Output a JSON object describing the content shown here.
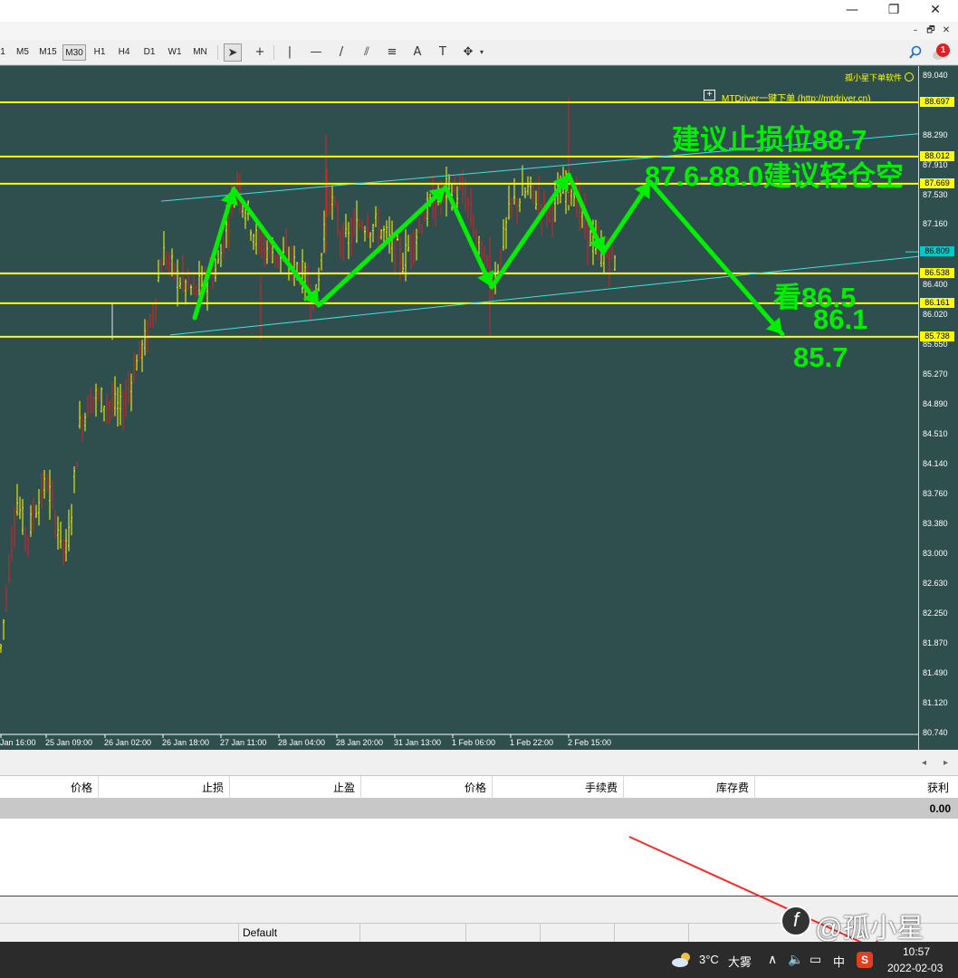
{
  "window": {
    "minimize_glyph": "—",
    "restore_glyph": "❐",
    "close_glyph": "✕"
  },
  "mdi": {
    "minimize_glyph": "–",
    "restore_glyph": "🗗",
    "close_glyph": "✕"
  },
  "toolbar": {
    "timeframes": [
      "1",
      "M5",
      "M15",
      "M30",
      "H1",
      "H4",
      "D1",
      "W1",
      "MN"
    ],
    "selected_timeframe": "M30",
    "tools": [
      "cursor-tool",
      "crosshair-tool",
      "vertical-line-tool",
      "horizontal-line-tool",
      "trendline-tool",
      "fibonacci-tool",
      "channel-tool",
      "text-tool",
      "text-label-tool",
      "arrows-tool"
    ],
    "tool_glyphs": [
      "➤",
      "+",
      "|",
      "—",
      "/",
      "⫽",
      "≡",
      "A",
      "T",
      "✥"
    ],
    "search_icon": "search-icon",
    "notification_count": "1"
  },
  "chart": {
    "background": "#2f4f4f",
    "watermark_text": "孤小星下单软件",
    "mtdriver_button": "+",
    "mtdriver_text": "MTDriver一键下单 (http://mtdriver.cn)",
    "price_ticks": [
      "89.040",
      "88.290",
      "87.910",
      "87.530",
      "87.160",
      "86.400",
      "86.020",
      "85.650",
      "85.270",
      "84.890",
      "84.510",
      "84.140",
      "83.760",
      "83.380",
      "83.000",
      "82.630",
      "82.250",
      "81.870",
      "81.490",
      "81.120",
      "80.740"
    ],
    "horizontal_lines": [
      "88.697",
      "88.012",
      "87.669",
      "86.538",
      "86.161",
      "85.738"
    ],
    "bid_price": "86.809",
    "time_ticks": [
      "Jan 16:00",
      "25 Jan 09:00",
      "26 Jan 02:00",
      "26 Jan 18:00",
      "27 Jan 11:00",
      "28 Jan 04:00",
      "28 Jan 20:00",
      "31 Jan 13:00",
      "1 Feb 06:00",
      "1 Feb 22:00",
      "2 Feb 15:00"
    ],
    "colors": {
      "hline": "#ffff00",
      "channel": "#40e0e0",
      "candle_up": "#ffff00",
      "candle_down": "#dd2222",
      "annotation": "#00ee00",
      "price_scale_text": "#ffffff"
    }
  },
  "annotations": {
    "stop_loss": "建议止损位88.7",
    "short_zone": "87.6-88.0建议轻仓空",
    "target_1": "看86.5",
    "target_2": "86.1",
    "target_3": "85.7"
  },
  "terminal": {
    "columns": [
      "价格",
      "止损",
      "止盈",
      "价格",
      "手续费",
      "库存费",
      "获利"
    ],
    "total_profit": "0.00"
  },
  "statusbar": {
    "profile": "Default",
    "watermark": "@孤小星"
  },
  "taskbar": {
    "weather_icon": "cloud-sun-icon",
    "temperature": "3°C",
    "weather_desc": "大雾",
    "ime": "中",
    "time": "10:57",
    "date": "2022-02-03"
  }
}
